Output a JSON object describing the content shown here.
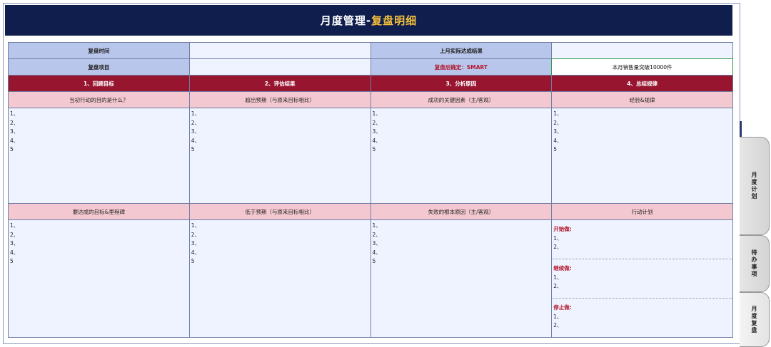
{
  "title": {
    "main": "月度管理-",
    "accent": "复盘明细"
  },
  "info": {
    "review_time_label": "复盘时间",
    "review_time_value": "",
    "last_month_label": "上月实际达成结果",
    "last_month_value": "",
    "project_label": "复盘项目",
    "project_value": "",
    "confirm_label": "复盘后确定：SMART",
    "confirm_value": "本月销售量突破10000件"
  },
  "steps": [
    "1、回顾目标",
    "2、评估结果",
    "3、分析原因",
    "4、总结规律"
  ],
  "sub1": [
    "当初行动的目的是什么？",
    "超出预期（与原来目标相比）",
    "成功的关键因素（主/客观）",
    "经验&规律"
  ],
  "sub2": [
    "要达成的目标&里程碑",
    "低于预期（与原来目标相比）",
    "失败的根本原因（主/客观）",
    "行动计划"
  ],
  "list_items": [
    "1、",
    "2、",
    "3、",
    "4、",
    "5"
  ],
  "plan": {
    "start_label": "开始做:",
    "continue_label": "继续做:",
    "stop_label": "停止做:",
    "items": [
      "1、",
      "2、"
    ]
  },
  "tabs": [
    "月度计划",
    "待办事项",
    "月度复盘"
  ],
  "colors": {
    "title_bg": "#101e4e",
    "accent": "#f5c23a",
    "step_bg": "#981530",
    "sub_bg": "#f4c8d0",
    "label_bg": "#b8c6ec"
  }
}
